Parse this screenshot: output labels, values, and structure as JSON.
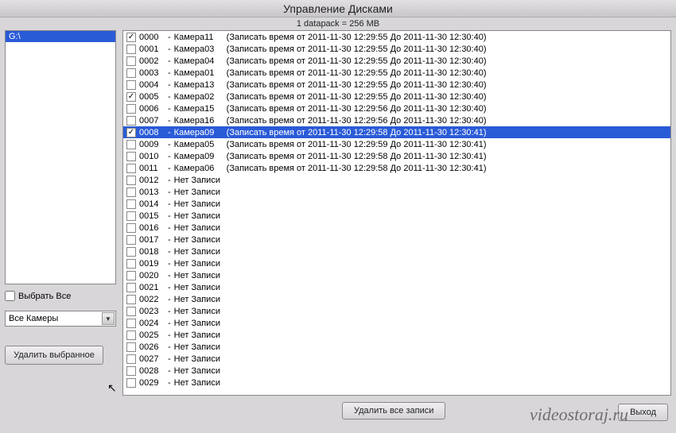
{
  "window_title": "Управление Дисками",
  "info_text": "1 datapack = 256 MB",
  "drives": [
    {
      "label": "G:\\",
      "selected": true
    }
  ],
  "select_all_label": "Выбрать Все",
  "select_all_checked": false,
  "camera_filter_value": "Все Камеры",
  "btn_delete_selected": "Удалить выбранное",
  "btn_delete_all": "Удалить все записи",
  "btn_exit": "Выход",
  "watermark": "videostoraj.ru",
  "records": [
    {
      "idx": "0000",
      "camera": "Камера11",
      "time": "(Записать время от 2011-11-30 12:29:55 До 2011-11-30 12:30:40)",
      "checked": true,
      "selected": false
    },
    {
      "idx": "0001",
      "camera": "Камера03",
      "time": "(Записать время от 2011-11-30 12:29:55 До 2011-11-30 12:30:40)",
      "checked": false,
      "selected": false
    },
    {
      "idx": "0002",
      "camera": "Камера04",
      "time": "(Записать время от 2011-11-30 12:29:55 До 2011-11-30 12:30:40)",
      "checked": false,
      "selected": false
    },
    {
      "idx": "0003",
      "camera": "Камера01",
      "time": "(Записать время от 2011-11-30 12:29:55 До 2011-11-30 12:30:40)",
      "checked": false,
      "selected": false
    },
    {
      "idx": "0004",
      "camera": "Камера13",
      "time": "(Записать время от 2011-11-30 12:29:55 До 2011-11-30 12:30:40)",
      "checked": false,
      "selected": false
    },
    {
      "idx": "0005",
      "camera": "Камера02",
      "time": "(Записать время от 2011-11-30 12:29:55 До 2011-11-30 12:30:40)",
      "checked": true,
      "selected": false
    },
    {
      "idx": "0006",
      "camera": "Камера15",
      "time": "(Записать время от 2011-11-30 12:29:56 До 2011-11-30 12:30:40)",
      "checked": false,
      "selected": false
    },
    {
      "idx": "0007",
      "camera": "Камера16",
      "time": "(Записать время от 2011-11-30 12:29:56 До 2011-11-30 12:30:40)",
      "checked": false,
      "selected": false
    },
    {
      "idx": "0008",
      "camera": "Камера09",
      "time": "(Записать время от 2011-11-30 12:29:58 До 2011-11-30 12:30:41)",
      "checked": true,
      "selected": true
    },
    {
      "idx": "0009",
      "camera": "Камера05",
      "time": "(Записать время от 2011-11-30 12:29:59 До 2011-11-30 12:30:41)",
      "checked": false,
      "selected": false
    },
    {
      "idx": "0010",
      "camera": "Камера09",
      "time": "(Записать время от 2011-11-30 12:29:58 До 2011-11-30 12:30:41)",
      "checked": false,
      "selected": false
    },
    {
      "idx": "0011",
      "camera": "Камера06",
      "time": "(Записать время от 2011-11-30 12:29:58 До 2011-11-30 12:30:41)",
      "checked": false,
      "selected": false
    },
    {
      "idx": "0012",
      "camera": "Нет Записи",
      "time": "",
      "checked": false,
      "selected": false
    },
    {
      "idx": "0013",
      "camera": "Нет Записи",
      "time": "",
      "checked": false,
      "selected": false
    },
    {
      "idx": "0014",
      "camera": "Нет Записи",
      "time": "",
      "checked": false,
      "selected": false
    },
    {
      "idx": "0015",
      "camera": "Нет Записи",
      "time": "",
      "checked": false,
      "selected": false
    },
    {
      "idx": "0016",
      "camera": "Нет Записи",
      "time": "",
      "checked": false,
      "selected": false
    },
    {
      "idx": "0017",
      "camera": "Нет Записи",
      "time": "",
      "checked": false,
      "selected": false
    },
    {
      "idx": "0018",
      "camera": "Нет Записи",
      "time": "",
      "checked": false,
      "selected": false
    },
    {
      "idx": "0019",
      "camera": "Нет Записи",
      "time": "",
      "checked": false,
      "selected": false
    },
    {
      "idx": "0020",
      "camera": "Нет Записи",
      "time": "",
      "checked": false,
      "selected": false
    },
    {
      "idx": "0021",
      "camera": "Нет Записи",
      "time": "",
      "checked": false,
      "selected": false
    },
    {
      "idx": "0022",
      "camera": "Нет Записи",
      "time": "",
      "checked": false,
      "selected": false
    },
    {
      "idx": "0023",
      "camera": "Нет Записи",
      "time": "",
      "checked": false,
      "selected": false
    },
    {
      "idx": "0024",
      "camera": "Нет Записи",
      "time": "",
      "checked": false,
      "selected": false
    },
    {
      "idx": "0025",
      "camera": "Нет Записи",
      "time": "",
      "checked": false,
      "selected": false
    },
    {
      "idx": "0026",
      "camera": "Нет Записи",
      "time": "",
      "checked": false,
      "selected": false
    },
    {
      "idx": "0027",
      "camera": "Нет Записи",
      "time": "",
      "checked": false,
      "selected": false
    },
    {
      "idx": "0028",
      "camera": "Нет Записи",
      "time": "",
      "checked": false,
      "selected": false
    },
    {
      "idx": "0029",
      "camera": "Нет Записи",
      "time": "",
      "checked": false,
      "selected": false
    }
  ]
}
